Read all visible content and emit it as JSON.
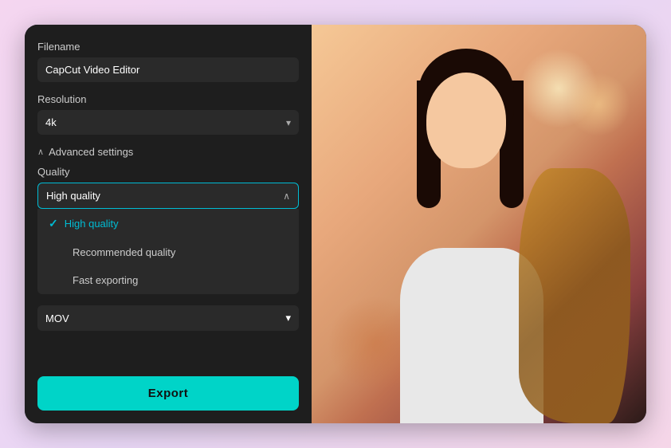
{
  "app": {
    "title": "CapCut Video Editor Export"
  },
  "left_panel": {
    "filename_label": "Filename",
    "filename_value": "CapCut Video Editor",
    "resolution_label": "Resolution",
    "resolution_value": "4k",
    "resolution_chevron": "▾",
    "advanced_settings_label": "Advanced settings",
    "advanced_caret": "∧",
    "quality_label": "Quality",
    "quality_selected": "High quality",
    "quality_chevron_up": "∧",
    "dropdown_items": [
      {
        "id": "high-quality",
        "label": "High quality",
        "selected": true
      },
      {
        "id": "recommended-quality",
        "label": "Recommended quality",
        "selected": false
      },
      {
        "id": "fast-exporting",
        "label": "Fast exporting",
        "selected": false
      }
    ],
    "format_value": "MOV",
    "format_chevron": "▾",
    "export_button_label": "Export"
  },
  "colors": {
    "accent": "#00d4c8",
    "background": "#1e1e1e",
    "surface": "#2a2a2a",
    "text_primary": "#ffffff",
    "text_secondary": "#cccccc"
  }
}
